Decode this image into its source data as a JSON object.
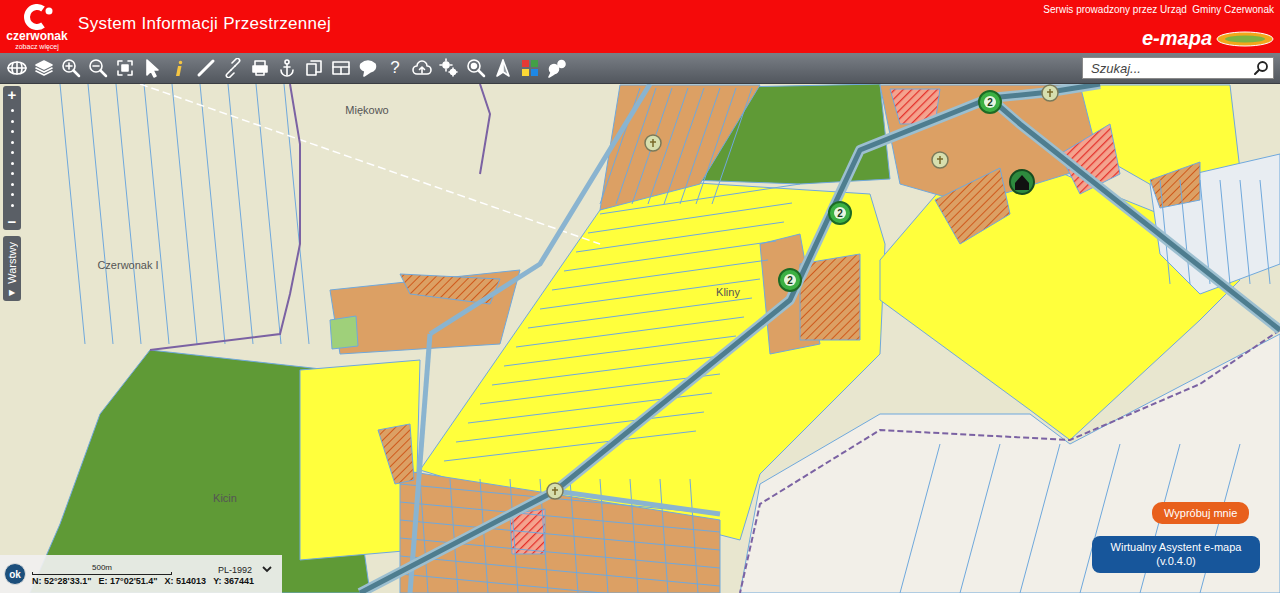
{
  "header": {
    "logo": "czerwonak",
    "logo_tagline": "zobacz więcej",
    "title": "System Informacji Przestrzennej",
    "operator": "Serwis prowadzony przez Urząd  Gminy Czerwonak",
    "brand": "e-mapa"
  },
  "toolbar": {
    "help": "?",
    "search": {
      "placeholder": "Szukaj..."
    }
  },
  "zoom": {
    "in": "+",
    "out": "−"
  },
  "layers_tab": {
    "label": "Warstwy",
    "arrow": "▶"
  },
  "map": {
    "places": [
      "Miękowo",
      "Czerwonak I",
      "Kliny",
      "Kicin"
    ],
    "zone_markers": [
      "2",
      "2",
      "2"
    ]
  },
  "status_bar": {
    "ok_button": "ok",
    "scale": "500m",
    "projection": "PL-1992",
    "coordinates": [
      "N: 52°28'33.1\"",
      "E: 17°02'51.4\"",
      "X: 514013",
      "Y: 367441"
    ]
  },
  "assistant": {
    "bubble": "Wypróbuj mnie",
    "title": "Wirtualny Asystent e-mapa",
    "version": "(v.0.4.0)"
  }
}
